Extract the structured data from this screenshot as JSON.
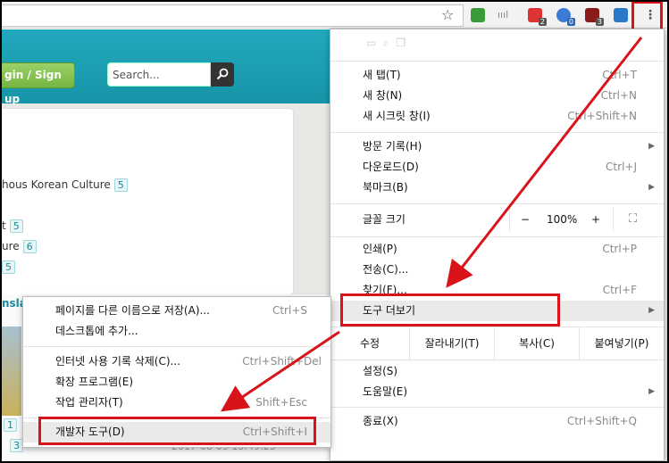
{
  "toolbar": {
    "bookmark_icon": "star-icon",
    "extensions": [
      {
        "name": "evernote",
        "color": "#3a9b3a",
        "badge": ""
      },
      {
        "name": "wifi",
        "color": "#888888",
        "badge": ""
      },
      {
        "name": "ext-red",
        "color": "#d33",
        "badge": "2"
      },
      {
        "name": "ext-blue",
        "color": "#3a7bd5",
        "badge": "0"
      },
      {
        "name": "ublock",
        "color": "#8b1a1a",
        "badge": "3"
      },
      {
        "name": "ext-x",
        "color": "#2a78c8",
        "badge": ""
      }
    ],
    "menu_icon": "⋮"
  },
  "site": {
    "login_label": "gin / Sign up",
    "search_placeholder": "Search...",
    "categories": [
      {
        "label": "hous Korean Culture",
        "count": "5"
      },
      {
        "label": "t",
        "count": "5"
      },
      {
        "label": "ure",
        "count": "6"
      },
      {
        "label": "",
        "count": "5"
      }
    ],
    "translate_label": "nsla",
    "date": "2017-08-09 15:49:25",
    "count1": "1",
    "count3": "3"
  },
  "menu": {
    "new_tab": {
      "label": "새 탭(T)",
      "shortcut": "Ctrl+T"
    },
    "new_window": {
      "label": "새 창(N)",
      "shortcut": "Ctrl+N"
    },
    "incognito": {
      "label": "새 시크릿 창(I)",
      "shortcut": "Ctrl+Shift+N"
    },
    "history": {
      "label": "방문 기록(H)"
    },
    "downloads": {
      "label": "다운로드(D)",
      "shortcut": "Ctrl+J"
    },
    "bookmarks": {
      "label": "북마크(B)"
    },
    "zoom": {
      "label": "글꼴 크기",
      "minus": "−",
      "value": "100%",
      "plus": "+"
    },
    "print": {
      "label": "인쇄(P)",
      "shortcut": "Ctrl+P"
    },
    "cast": {
      "label": "전송(C)..."
    },
    "find": {
      "label": "찾기(F)...",
      "shortcut": "Ctrl+F"
    },
    "more_tools": {
      "label": "도구 더보기"
    },
    "edit": {
      "label": "수정",
      "cut": "잘라내기(T)",
      "copy": "복사(C)",
      "paste": "붙여넣기(P)"
    },
    "settings": {
      "label": "설정(S)"
    },
    "help": {
      "label": "도움말(E)"
    },
    "exit": {
      "label": "종료(X)",
      "shortcut": "Ctrl+Shift+Q"
    }
  },
  "submenu": {
    "save_page": {
      "label": "페이지를 다른 이름으로 저장(A)...",
      "shortcut": "Ctrl+S"
    },
    "add_desktop": {
      "label": "데스크톱에 추가..."
    },
    "clear_data": {
      "label": "인터넷 사용 기록 삭제(C)...",
      "shortcut": "Ctrl+Shift+Del"
    },
    "extensions": {
      "label": "확장 프로그램(E)"
    },
    "task_manager": {
      "label": "작업 관리자(T)",
      "shortcut": "Shift+Esc"
    },
    "dev_tools": {
      "label": "개발자 도구(D)",
      "shortcut": "Ctrl+Shift+I"
    }
  },
  "highlight_color": "#d8141a"
}
